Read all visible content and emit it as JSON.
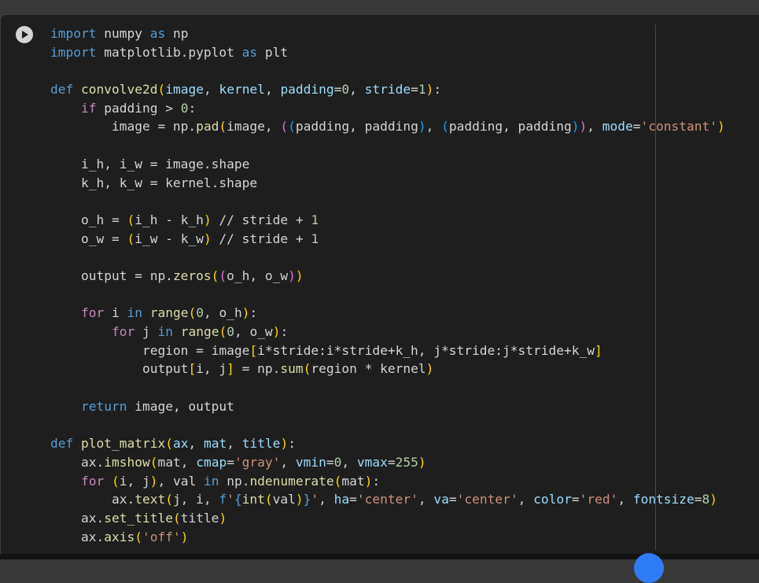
{
  "cell": {
    "run_icon": "play-icon",
    "lines": [
      "import numpy as np",
      "import matplotlib.pyplot as plt",
      "",
      "def convolve2d(image, kernel, padding=0, stride=1):",
      "    if padding > 0:",
      "        image = np.pad(image, ((padding, padding), (padding, padding)), mode='constant')",
      "",
      "    i_h, i_w = image.shape",
      "    k_h, k_w = kernel.shape",
      "",
      "    o_h = (i_h - k_h) // stride + 1",
      "    o_w = (i_w - k_w) // stride + 1",
      "",
      "    output = np.zeros((o_h, o_w))",
      "",
      "    for i in range(0, o_h):",
      "        for j in range(0, o_w):",
      "            region = image[i*stride:i*stride+k_h, j*stride:j*stride+k_w]",
      "            output[i, j] = np.sum(region * kernel)",
      "",
      "    return image, output",
      "",
      "def plot_matrix(ax, mat, title):",
      "    ax.imshow(mat, cmap='gray', vmin=0, vmax=255)",
      "    for (i, j), val in np.ndenumerate(mat):",
      "        ax.text(j, i, f'{int(val)}', ha='center', va='center', color='red', fontsize=8)",
      "    ax.set_title(title)",
      "    ax.axis('off')"
    ]
  },
  "colors": {
    "background": "#1e1e1e",
    "keyword": "#569cd6",
    "control_keyword": "#c586c0",
    "function": "#dcdcaa",
    "number": "#b5cea8",
    "string": "#ce9178",
    "parameter": "#9cdcfe"
  }
}
